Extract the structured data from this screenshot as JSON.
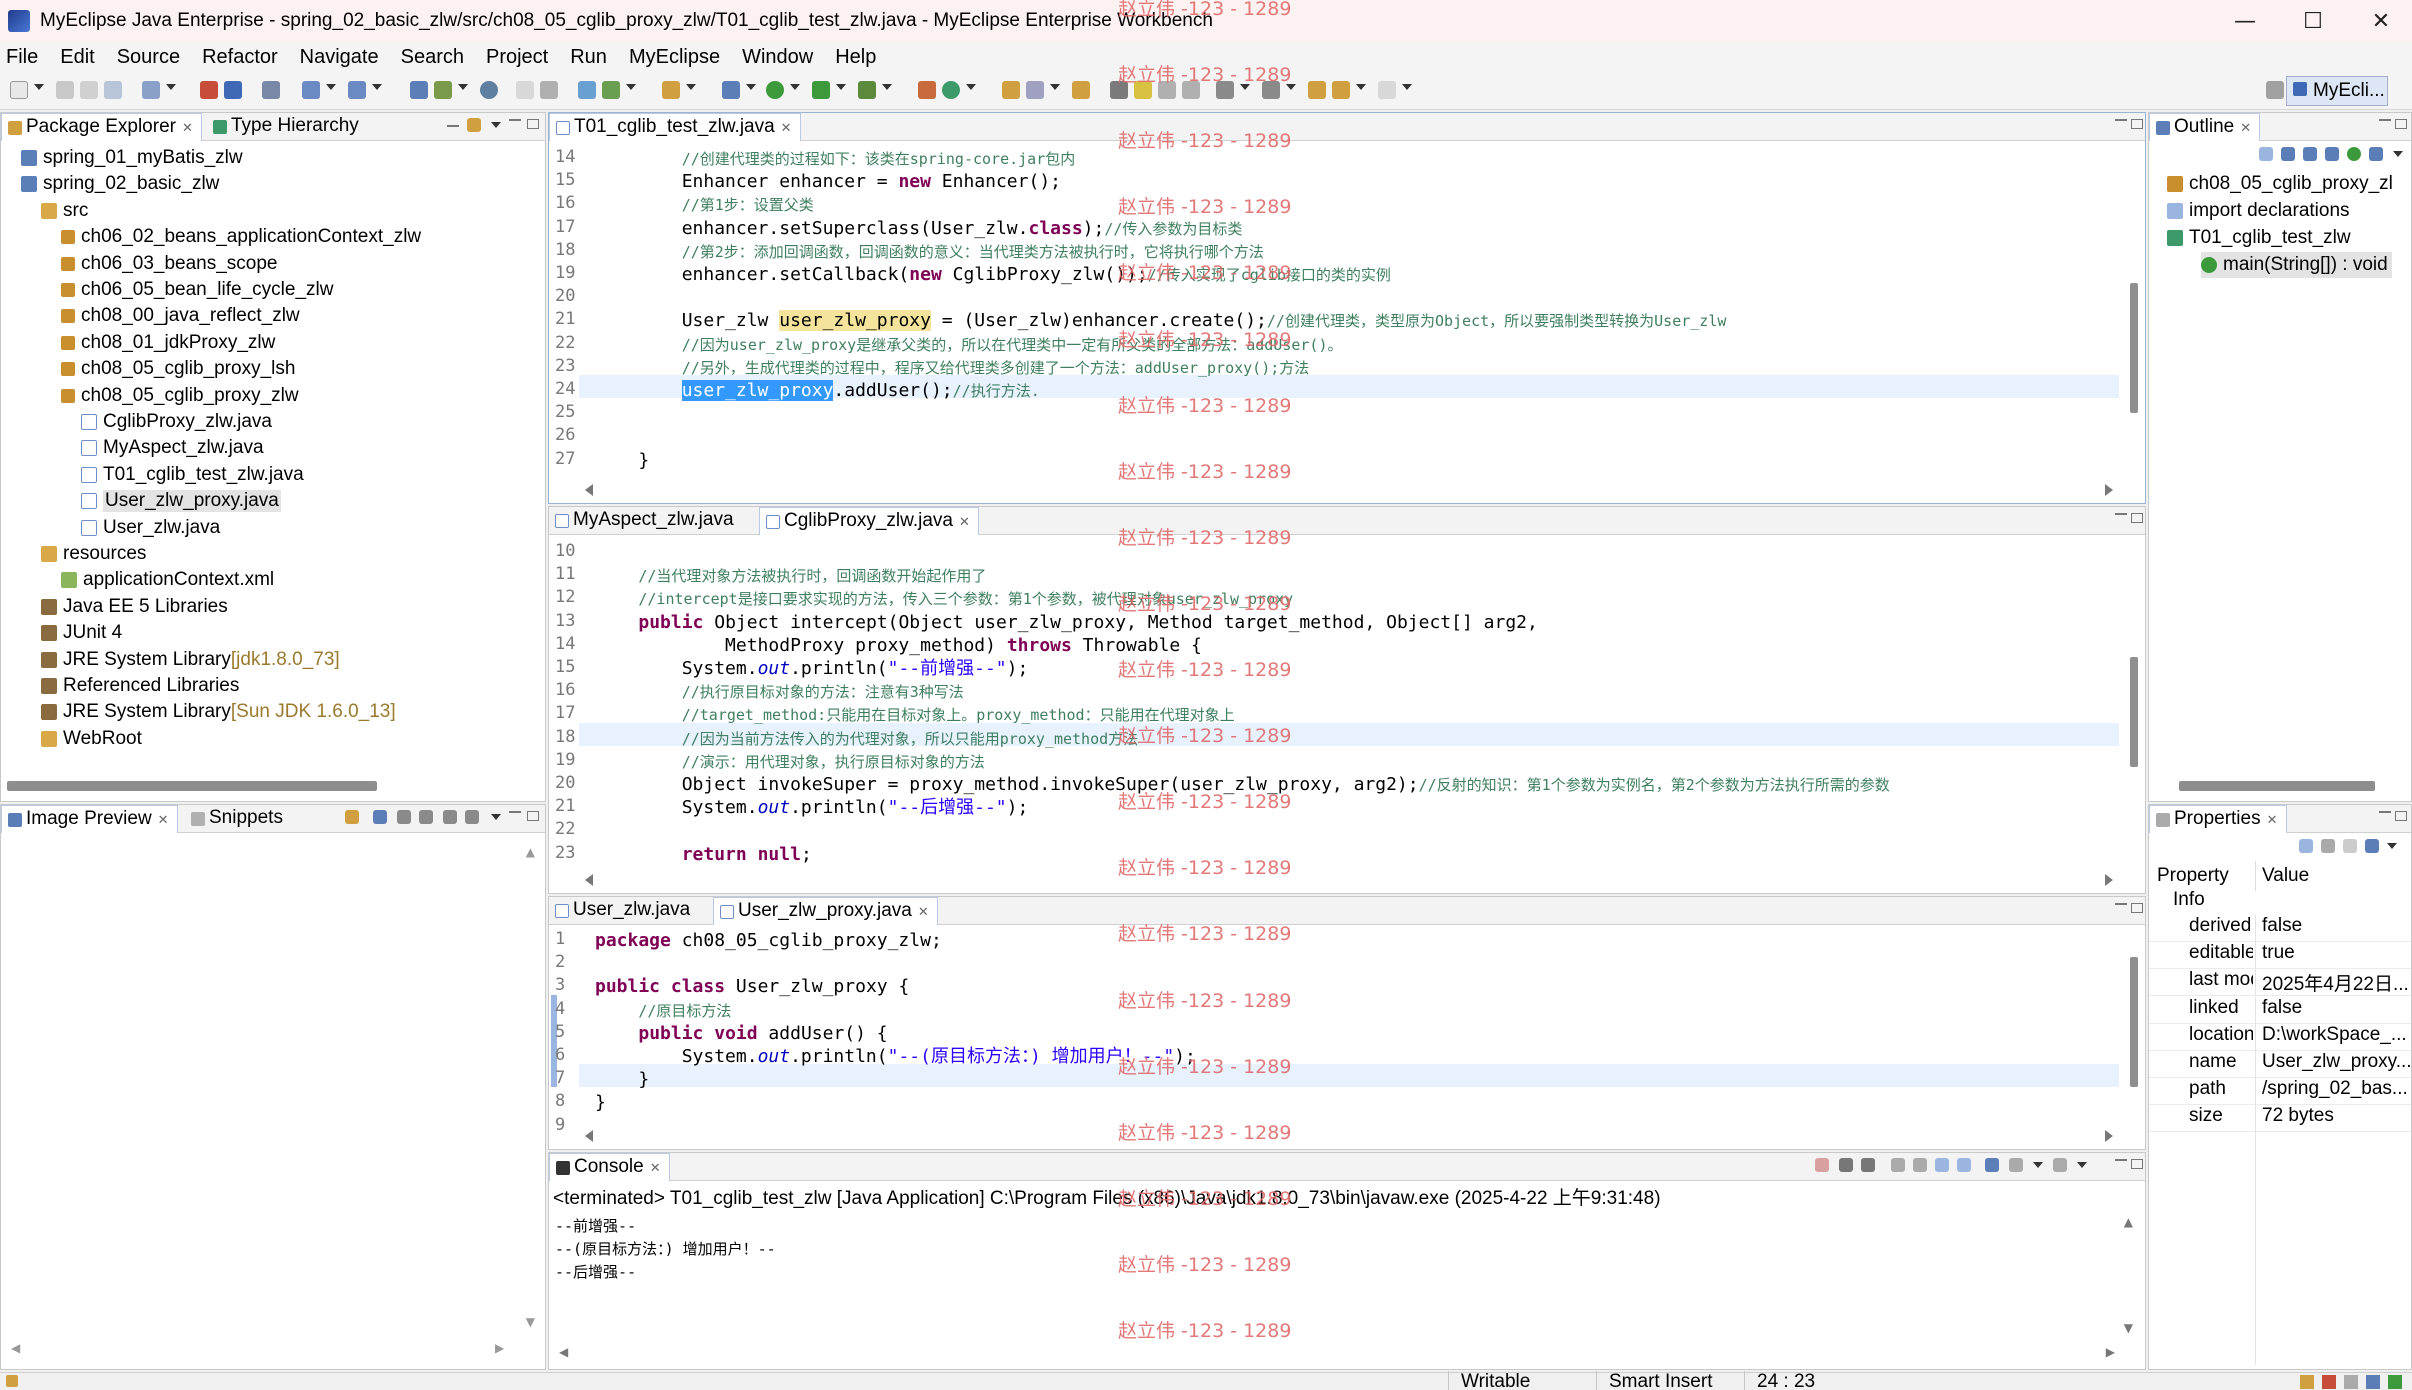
{
  "window": {
    "title": "MyEclipse Java Enterprise - spring_02_basic_zlw/src/ch08_05_cglib_proxy_zlw/T01_cglib_test_zlw.java - MyEclipse Enterprise Workbench",
    "minimize": "—",
    "maximize": "☐",
    "close": "✕"
  },
  "menu": [
    "File",
    "Edit",
    "Source",
    "Refactor",
    "Navigate",
    "Search",
    "Project",
    "Run",
    "MyEclipse",
    "Window",
    "Help"
  ],
  "perspective": "MyEcli...",
  "package_explorer": {
    "tabs": [
      "Package Explorer",
      "Type Hierarchy"
    ],
    "items": [
      {
        "label": "spring_01_myBatis_zlw",
        "icon": "project-icon"
      },
      {
        "label": "spring_02_basic_zlw",
        "icon": "project-icon"
      },
      {
        "label": "src",
        "icon": "folder-icon"
      },
      {
        "label": "ch06_02_beans_applicationContext_zlw",
        "icon": "package-icon"
      },
      {
        "label": "ch06_03_beans_scope",
        "icon": "package-icon"
      },
      {
        "label": "ch06_05_bean_life_cycle_zlw",
        "icon": "package-icon"
      },
      {
        "label": "ch08_00_java_reflect_zlw",
        "icon": "package-icon"
      },
      {
        "label": "ch08_01_jdkProxy_zlw",
        "icon": "package-icon"
      },
      {
        "label": "ch08_05_cglib_proxy_lsh",
        "icon": "package-icon"
      },
      {
        "label": "ch08_05_cglib_proxy_zlw",
        "icon": "package-icon"
      },
      {
        "label": "CglibProxy_zlw.java",
        "icon": "java-file-icon"
      },
      {
        "label": "MyAspect_zlw.java",
        "icon": "java-file-icon"
      },
      {
        "label": "T01_cglib_test_zlw.java",
        "icon": "java-file-icon"
      },
      {
        "label": "User_zlw_proxy.java",
        "icon": "java-file-icon"
      },
      {
        "label": "User_zlw.java",
        "icon": "java-file-icon"
      },
      {
        "label": "resources",
        "icon": "folder-icon"
      },
      {
        "label": "applicationContext.xml",
        "icon": "xml-file-icon"
      },
      {
        "label": "Java EE 5 Libraries",
        "icon": "library-icon"
      },
      {
        "label": "JUnit 4",
        "icon": "library-icon"
      },
      {
        "label": "JRE System Library",
        "suffix": "[jdk1.8.0_73]",
        "icon": "library-icon"
      },
      {
        "label": "Referenced Libraries",
        "icon": "library-icon"
      },
      {
        "label": "JRE System Library",
        "suffix": "[Sun JDK 1.6.0_13]",
        "icon": "library-icon"
      },
      {
        "label": "WebRoot",
        "icon": "folder-icon"
      }
    ]
  },
  "image_preview": {
    "tabs": [
      "Image Preview",
      "Snippets"
    ]
  },
  "editor1": {
    "tab": "T01_cglib_test_zlw.java",
    "lines": [
      {
        "n": "14",
        "code": "        //创建代理类的过程如下：该类在spring-core.jar包内"
      },
      {
        "n": "15",
        "code": "        Enhancer enhancer = new Enhancer();"
      },
      {
        "n": "16",
        "code": "        //第1步：设置父类"
      },
      {
        "n": "17",
        "code": "        enhancer.setSuperclass(User_zlw.class);//传入参数为目标类"
      },
      {
        "n": "18",
        "code": "        //第2步：添加回调函数，回调函数的意义：当代理类方法被执行时，它将执行哪个方法"
      },
      {
        "n": "19",
        "code": "        enhancer.setCallback(new CglibProxy_zlw());//传入实现了cglib接口的类的实例"
      },
      {
        "n": "20",
        "code": ""
      },
      {
        "n": "21",
        "code": "        User_zlw user_zlw_proxy = (User_zlw)enhancer.create();//创建代理类，类型原为Object，所以要强制类型转换为User_zlw"
      },
      {
        "n": "22",
        "code": "        //因为user_zlw_proxy是继承父类的，所以在代理类中一定有所父类的全部方法：addUser()。"
      },
      {
        "n": "23",
        "code": "        //另外，生成代理类的过程中，程序又给代理类多创建了一个方法：addUser_proxy();方法"
      },
      {
        "n": "24",
        "code": "        user_zlw_proxy.addUser();//执行方法."
      },
      {
        "n": "25",
        "code": ""
      },
      {
        "n": "26",
        "code": ""
      },
      {
        "n": "27",
        "code": "    }"
      }
    ]
  },
  "editor2": {
    "tabs": [
      "MyAspect_zlw.java",
      "CglibProxy_zlw.java"
    ],
    "lines": [
      {
        "n": "10",
        "code": ""
      },
      {
        "n": "11",
        "code": "    //当代理对象方法被执行时，回调函数开始起作用了"
      },
      {
        "n": "12",
        "code": "    //intercept是接口要求实现的方法，传入三个参数：第1个参数，被代理对象user_zlw_proxy"
      },
      {
        "n": "13",
        "code": "    public Object intercept(Object user_zlw_proxy, Method target_method, Object[] arg2,"
      },
      {
        "n": "14",
        "code": "            MethodProxy proxy_method) throws Throwable {"
      },
      {
        "n": "15",
        "code": "        System.out.println(\"--前增强--\");"
      },
      {
        "n": "16",
        "code": "        //执行原目标对象的方法：注意有3种写法"
      },
      {
        "n": "17",
        "code": "        //target_method:只能用在目标对象上。proxy_method：只能用在代理对象上"
      },
      {
        "n": "18",
        "code": "        //因为当前方法传入的为代理对象，所以只能用proxy_method方法"
      },
      {
        "n": "19",
        "code": "        //演示：用代理对象，执行原目标对象的方法"
      },
      {
        "n": "20",
        "code": "        Object invokeSuper = proxy_method.invokeSuper(user_zlw_proxy, arg2);//反射的知识：第1个参数为实例名，第2个参数为方法执行所需的参数"
      },
      {
        "n": "21",
        "code": "        System.out.println(\"--后增强--\");"
      },
      {
        "n": "22",
        "code": ""
      },
      {
        "n": "23",
        "code": "        return null;"
      }
    ]
  },
  "editor3": {
    "tabs": [
      "User_zlw.java",
      "User_zlw_proxy.java"
    ],
    "lines": [
      {
        "n": "1",
        "code": "package ch08_05_cglib_proxy_zlw;"
      },
      {
        "n": "2",
        "code": ""
      },
      {
        "n": "3",
        "code": "public class User_zlw_proxy {"
      },
      {
        "n": "4",
        "code": "    //原目标方法"
      },
      {
        "n": "5",
        "code": "    public void addUser() {"
      },
      {
        "n": "6",
        "code": "        System.out.println(\"--(原目标方法：) 增加用户！--\");"
      },
      {
        "n": "7",
        "code": "    }"
      },
      {
        "n": "8",
        "code": "}"
      },
      {
        "n": "9",
        "code": ""
      }
    ]
  },
  "console": {
    "tab": "Console",
    "header": "<terminated> T01_cglib_test_zlw [Java Application] C:\\Program Files (x86)\\Java\\jdk1.8.0_73\\bin\\javaw.exe (2025-4-22 上午9:31:48)",
    "lines": [
      "--前增强--",
      "--(原目标方法：) 增加用户！--",
      "--后增强--"
    ]
  },
  "outline": {
    "tab": "Outline",
    "items": [
      {
        "label": "ch08_05_cglib_proxy_zl"
      },
      {
        "label": "import declarations"
      },
      {
        "label": "T01_cglib_test_zlw"
      },
      {
        "label": "main(String[]) : void"
      }
    ]
  },
  "properties": {
    "tab": "Properties",
    "header_property": "Property",
    "header_value": "Value",
    "category": "Info",
    "rows": [
      {
        "k": "derived",
        "v": "false"
      },
      {
        "k": "editable",
        "v": "true"
      },
      {
        "k": "last modified",
        "v": "2025年4月22日..."
      },
      {
        "k": "linked",
        "v": "false"
      },
      {
        "k": "location",
        "v": "D:\\workSpace_..."
      },
      {
        "k": "name",
        "v": "User_zlw_proxy..."
      },
      {
        "k": "path",
        "v": "/spring_02_bas..."
      },
      {
        "k": "size",
        "v": "72  bytes"
      }
    ]
  },
  "status": {
    "writable": "Writable",
    "insert": "Smart Insert",
    "position": "24 : 23"
  },
  "watermark": "赵立伟 -123 - 1289"
}
